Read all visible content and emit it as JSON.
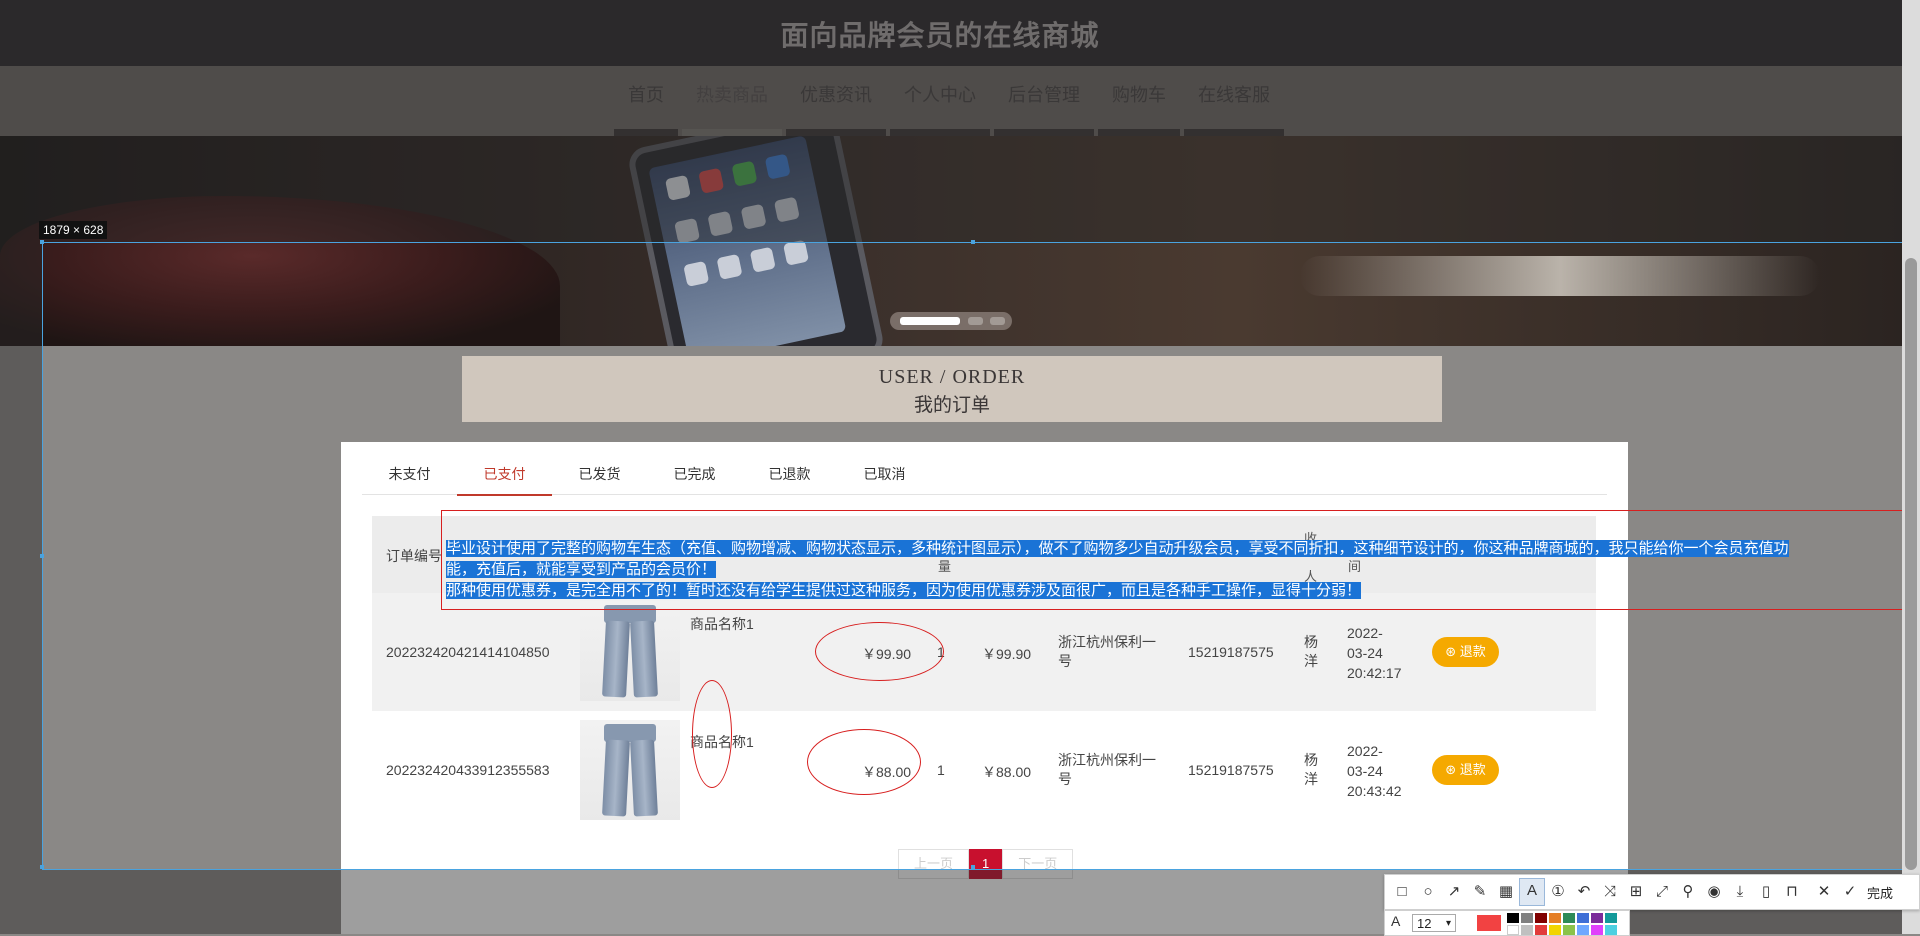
{
  "site": {
    "title": "面向品牌会员的在线商城"
  },
  "nav": {
    "items": [
      {
        "label": "首页"
      },
      {
        "label": "热卖商品",
        "active": true
      },
      {
        "label": "优惠资讯"
      },
      {
        "label": "个人中心"
      },
      {
        "label": "后台管理"
      },
      {
        "label": "购物车"
      },
      {
        "label": "在线客服"
      }
    ]
  },
  "section": {
    "title_en": "USER / ORDER",
    "title_cn": "我的订单"
  },
  "tabs": [
    {
      "label": "未支付"
    },
    {
      "label": "已支付",
      "active": true
    },
    {
      "label": "已发货"
    },
    {
      "label": "已完成"
    },
    {
      "label": "已退款"
    },
    {
      "label": "已取消"
    }
  ],
  "table": {
    "header_order_no": "订单编号",
    "header_peek_1": "量",
    "header_peek_2": "收",
    "header_peek_3": "人",
    "header_peek_4": "间",
    "rows": [
      {
        "order_no": "202232420421414104850",
        "product": "商品名称1",
        "price": "￥99.90",
        "qty": "1",
        "total": "￥99.90",
        "address": "浙江杭州保利一号",
        "phone": "15219187575",
        "receiver": "杨洋",
        "time": "2022-03-24 20:42:17",
        "action": "退款"
      },
      {
        "order_no": "202232420433912355583",
        "product": "商品名称1",
        "price": "￥88.00",
        "qty": "1",
        "total": "￥88.00",
        "address": "浙江杭州保利一号",
        "phone": "15219187575",
        "receiver": "杨洋",
        "time": "2022-03-24 20:43:42",
        "action": "退款"
      }
    ]
  },
  "pager": {
    "prev": "上一页",
    "current": "1",
    "next": "下一页"
  },
  "capture": {
    "size_label": "1879 × 628"
  },
  "annotation": {
    "line1": "毕业设计使用了完整的购物车生态（充值、购物增减、购物状态显示，多种统计图显示），做不了购物多少自动升级会员，享受不同折扣，这种细节设计的，你这种品牌商城的，我只能给你一个会员充值功",
    "line2": "能，充值后，就能享受到产品的会员价！",
    "line3": "那种使用优惠券，是完全用不了的！暂时还没有给学生提供过这种服务，因为使用优惠券涉及面很广，而且是各种手工操作，显得十分弱！"
  },
  "toolbar": {
    "done_label": "完成",
    "font_size": "12",
    "icons": [
      "rectangle-icon",
      "ellipse-icon",
      "arrow-icon",
      "pen-icon",
      "mosaic-icon",
      "text-icon",
      "number-icon",
      "undo-icon",
      "redo-icon",
      "ocr-icon",
      "scroll-capture-icon",
      "pin-icon",
      "record-icon",
      "download-icon",
      "save-icon",
      "bookmark-icon",
      "close-icon",
      "check-icon"
    ]
  },
  "colors": {
    "accent": "#c0392b",
    "refund": "#f5a900",
    "selection": "#1a73d6",
    "annotation": "#d71f1f",
    "frame": "#4aa3df"
  }
}
